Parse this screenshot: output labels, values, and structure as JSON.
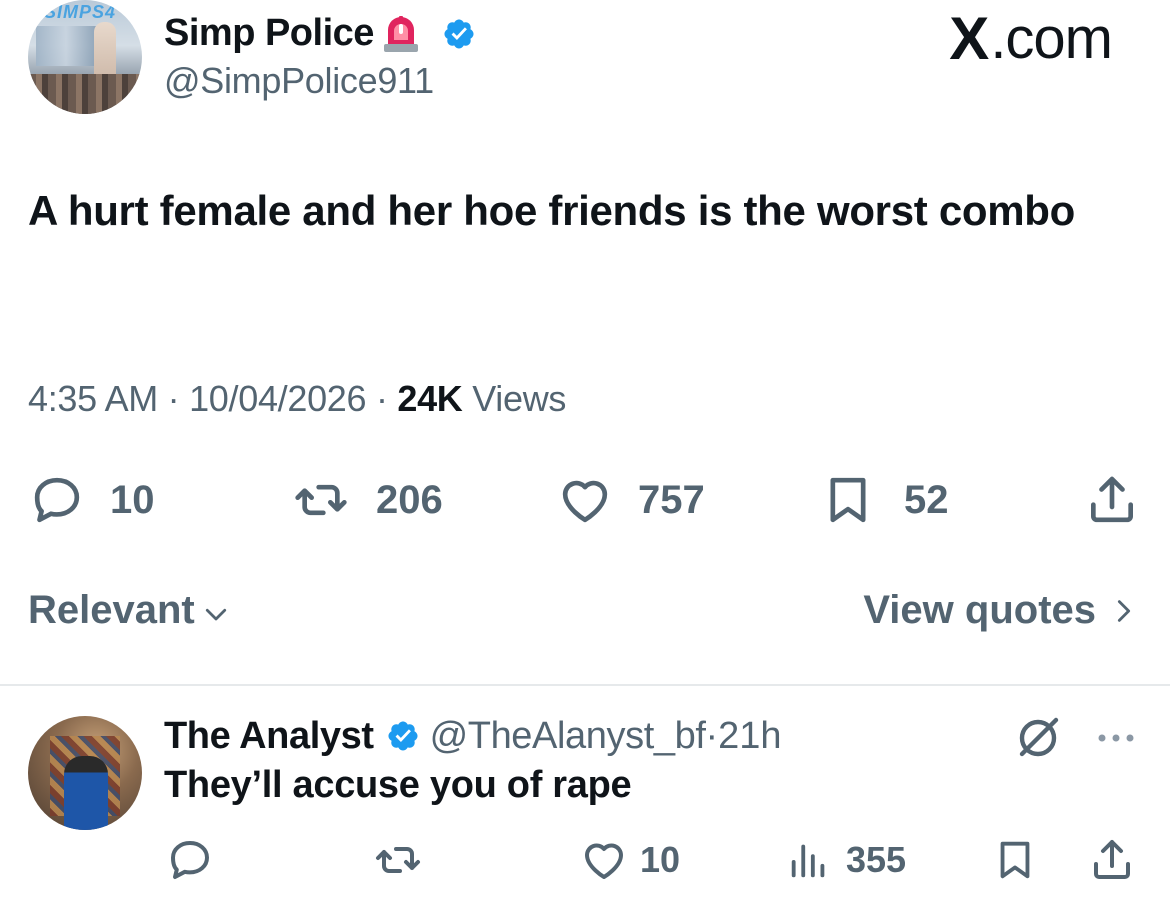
{
  "author": {
    "display_name": "Simp Police",
    "handle": "@SimpPolice911",
    "avatar_label": "SIMPS4"
  },
  "brand": {
    "text": ".com",
    "glyph": "X"
  },
  "tweet": {
    "text": "A hurt female and her hoe friends is the worst combo",
    "time": "4:35 AM",
    "sep1": " · ",
    "date": "10/04/2026",
    "sep2": " · ",
    "views_count": "24K",
    "views_label": " Views"
  },
  "stats": {
    "replies": "10",
    "reposts": "206",
    "likes": "757",
    "bookmarks": "52"
  },
  "sort": {
    "relevant_label": "Relevant",
    "view_quotes_label": "View quotes"
  },
  "reply": {
    "display_name": "The Analyst",
    "handle": "@TheAlanyst_bf",
    "sep": " · ",
    "time": "21h",
    "text": "They’ll accuse you of rape",
    "likes": "10",
    "views": "355"
  },
  "colors": {
    "text": "#0f1419",
    "secondary": "#536471",
    "verified": "#1d9bf0",
    "siren": "#e0245e"
  }
}
